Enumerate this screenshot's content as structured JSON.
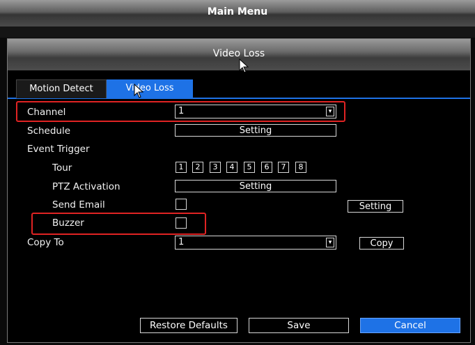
{
  "main_title": "Main Menu",
  "dialog_title": "Video Loss",
  "tabs": [
    {
      "label": "Motion Detect"
    },
    {
      "label": "Video Loss"
    }
  ],
  "form": {
    "channel": {
      "label": "Channel",
      "value": "1"
    },
    "schedule": {
      "label": "Schedule",
      "button": "Setting"
    },
    "event_trigger": {
      "label": "Event Trigger"
    },
    "tour": {
      "label": "Tour",
      "options": [
        "1",
        "2",
        "3",
        "4",
        "5",
        "6",
        "7",
        "8"
      ]
    },
    "ptz": {
      "label": "PTZ Activation",
      "button": "Setting"
    },
    "send_email": {
      "label": "Send Email",
      "button": "Setting",
      "checked": false
    },
    "buzzer": {
      "label": "Buzzer",
      "checked": false
    },
    "copy_to": {
      "label": "Copy To",
      "value": "1",
      "button": "Copy"
    }
  },
  "footer": {
    "restore": "Restore Defaults",
    "save": "Save",
    "cancel": "Cancel"
  },
  "colors": {
    "accent": "#1e72e6",
    "highlight": "#e02323"
  },
  "icons": [
    "dropdown-arrow-icon",
    "mouse-pointer-icon"
  ]
}
